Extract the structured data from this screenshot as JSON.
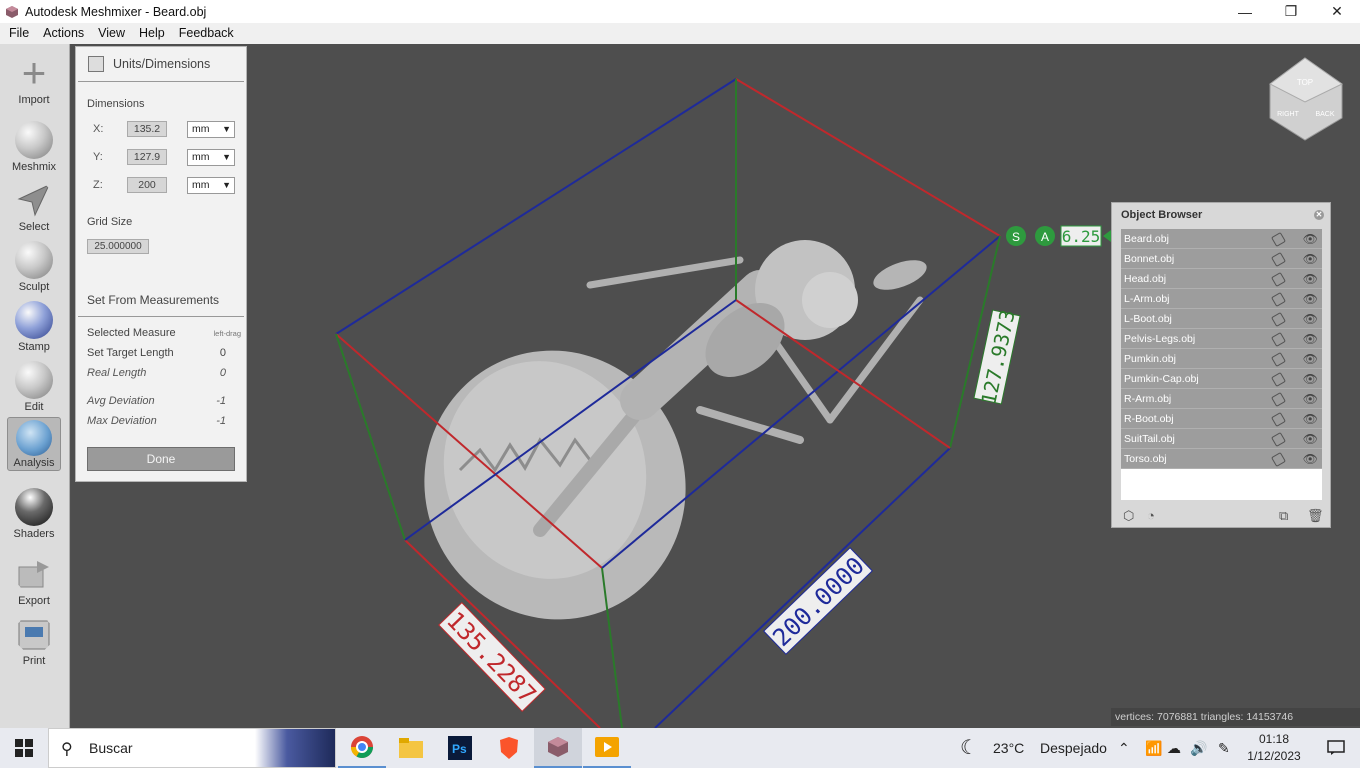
{
  "window": {
    "title": "Autodesk Meshmixer - Beard.obj",
    "minimize": "—",
    "maximize": "❐",
    "close": "✕"
  },
  "menu": [
    "File",
    "Actions",
    "View",
    "Help",
    "Feedback"
  ],
  "toolbar": [
    {
      "label": "Import",
      "icon": "plus-icon"
    },
    {
      "label": "Meshmix",
      "icon": "bunny-sphere-icon"
    },
    {
      "label": "Select",
      "icon": "select-arrow-icon"
    },
    {
      "label": "Sculpt",
      "icon": "brush-sphere-icon"
    },
    {
      "label": "Stamp",
      "icon": "fleur-sphere-icon"
    },
    {
      "label": "Edit",
      "icon": "edit-sphere-icon"
    },
    {
      "label": "Analysis",
      "icon": "analysis-sphere-icon",
      "active": true
    },
    {
      "label": "Shaders",
      "icon": "shader-sphere-icon"
    },
    {
      "label": "Export",
      "icon": "export-icon"
    },
    {
      "label": "Print",
      "icon": "printer-icon"
    }
  ],
  "units_panel": {
    "title": "Units/Dimensions",
    "dimensions_label": "Dimensions",
    "dims": [
      {
        "axis": "X:",
        "value": "135.2",
        "unit": "mm"
      },
      {
        "axis": "Y:",
        "value": "127.9",
        "unit": "mm"
      },
      {
        "axis": "Z:",
        "value": "200",
        "unit": "mm"
      }
    ],
    "grid_label": "Grid Size",
    "grid_value": "25.000000",
    "measure_section": "Set From Measurements",
    "selected_measure": "Selected Measure",
    "selected_measure_hint": "left-drag",
    "target_length": {
      "label": "Set Target Length",
      "value": "0"
    },
    "real_length": {
      "label": "Real Length",
      "value": "0"
    },
    "avg_dev": {
      "label": "Avg Deviation",
      "value": "-1"
    },
    "max_dev": {
      "label": "Max Deviation",
      "value": "-1"
    },
    "done": "Done"
  },
  "viewport": {
    "dim_x_label": "135.2287",
    "dim_z_label": "200.0000",
    "dim_y_label": "127.9373",
    "scale_badge_s": "S",
    "scale_badge_a": "A",
    "scale_value": "6.25",
    "viewcube_labels": [
      "TOP",
      "RIGHT",
      "BACK"
    ],
    "stats": "vertices: 7076881 triangles: 14153746",
    "colors": {
      "x_axis": "#c0282c",
      "y_axis": "#2a7a2a",
      "z_axis": "#1e2a9a"
    }
  },
  "object_browser": {
    "title": "Object Browser",
    "items": [
      "Beard.obj",
      "Bonnet.obj",
      "Head.obj",
      "L-Arm.obj",
      "L-Boot.obj",
      "Pelvis-Legs.obj",
      "Pumkin.obj",
      "Pumkin-Cap.obj",
      "R-Arm.obj",
      "R-Boot.obj",
      "SuitTail.obj",
      "Torso.obj"
    ]
  },
  "taskbar": {
    "search_placeholder": "Buscar",
    "weather_temp": "23°C",
    "weather_desc": "Despejado",
    "time": "01:18",
    "date": "1/12/2023",
    "apps": [
      "chrome-icon",
      "file-explorer-icon",
      "photoshop-icon",
      "brave-icon",
      "meshmixer-icon",
      "media-player-icon"
    ]
  }
}
